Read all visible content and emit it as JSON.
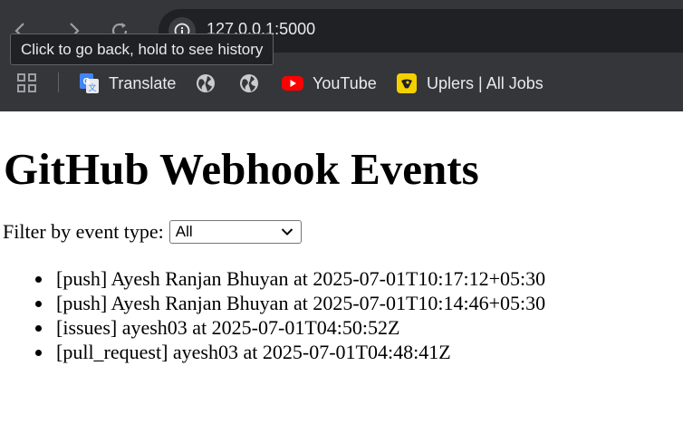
{
  "browser": {
    "url": "127.0.0.1:5000",
    "tooltip": "Click to go back, hold to see history",
    "bookmarks": [
      {
        "label": "Translate",
        "icon": "google-translate-icon"
      },
      {
        "label": "",
        "icon": "globe-icon"
      },
      {
        "label": "",
        "icon": "globe-icon"
      },
      {
        "label": "YouTube",
        "icon": "youtube-icon"
      },
      {
        "label": "Uplers | All Jobs",
        "icon": "uplers-icon"
      }
    ]
  },
  "page": {
    "title": "GitHub Webhook Events",
    "filter": {
      "label": "Filter by event type:",
      "selected": "All"
    },
    "events": [
      {
        "text": "[push] Ayesh Ranjan Bhuyan at 2025-07-01T10:17:12+05:30"
      },
      {
        "text": "[push] Ayesh Ranjan Bhuyan at 2025-07-01T10:14:46+05:30"
      },
      {
        "text": "[issues] ayesh03 at 2025-07-01T04:50:52Z"
      },
      {
        "text": "[pull_request] ayesh03 at 2025-07-01T04:48:41Z"
      }
    ]
  },
  "colors": {
    "chrome_bg": "#35363a",
    "omnibox_bg": "#202124",
    "chrome_text": "#e8eaed",
    "youtube_red": "#ff0000",
    "uplers_yellow": "#f5d000"
  }
}
